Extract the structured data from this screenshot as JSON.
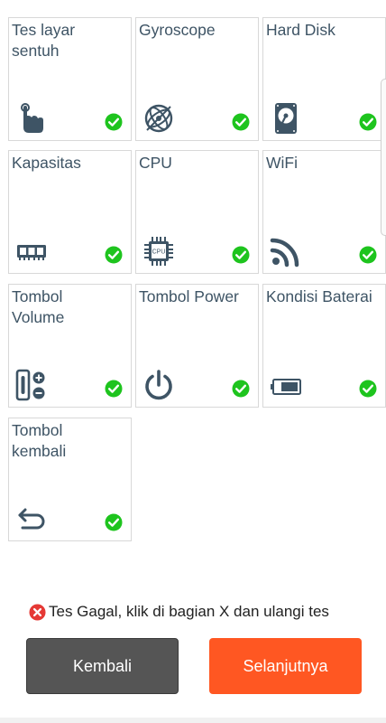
{
  "tiles": [
    {
      "label": "Tes layar\nsentuh",
      "icon": "touch-tap-icon"
    },
    {
      "label": "Gyroscope",
      "icon": "gyroscope-icon"
    },
    {
      "label": "Hard Disk",
      "icon": "hard-disk-icon"
    },
    {
      "label": "Kapasitas",
      "icon": "memory-ram-icon"
    },
    {
      "label": "CPU",
      "icon": "cpu-chip-icon"
    },
    {
      "label": "WiFi",
      "icon": "wifi-icon"
    },
    {
      "label": "Tombol\nVolume",
      "icon": "volume-buttons-icon"
    },
    {
      "label": "Tombol Power",
      "icon": "power-icon"
    },
    {
      "label": "Kondisi Baterai",
      "icon": "battery-icon"
    },
    {
      "label": "Tombol\nkembali",
      "icon": "back-arrow-icon"
    }
  ],
  "cpu_chip_text": "CPU",
  "status": {
    "message": "Tes Gagal, klik di bagian X dan ulangi tes",
    "icon": "error-x-icon",
    "color": "#e53935"
  },
  "buttons": {
    "back_label": "Kembali",
    "next_label": "Selanjutnya"
  },
  "colors": {
    "icon": "#3e5465",
    "check": "#1ec41e",
    "back_button": "#555555",
    "next_button": "#ff5722"
  }
}
